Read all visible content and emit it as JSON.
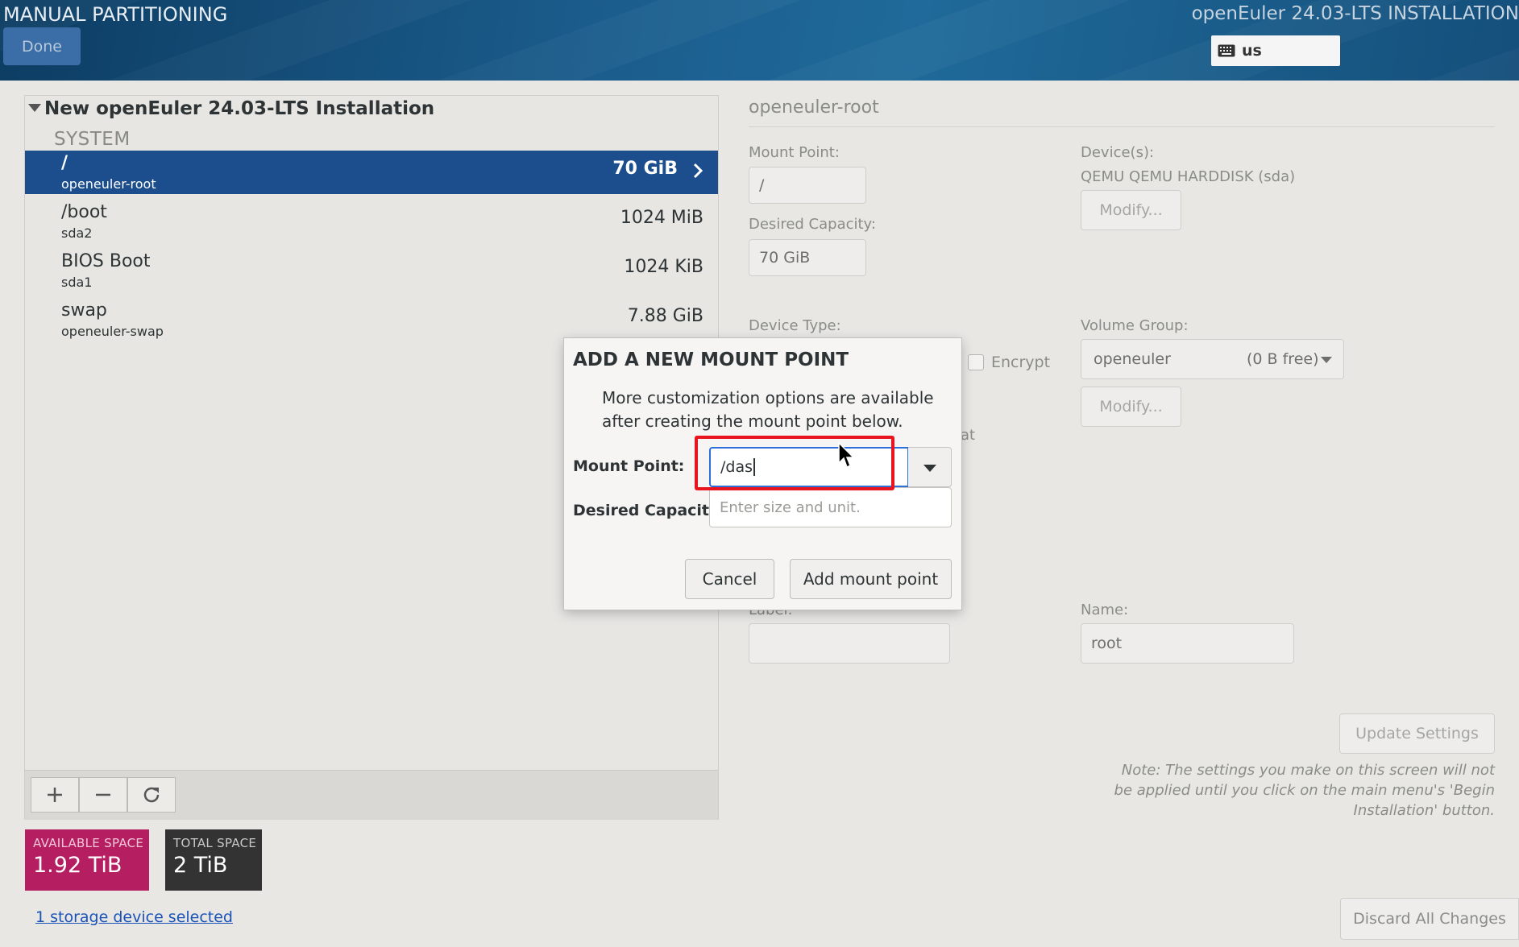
{
  "header": {
    "title": "MANUAL PARTITIONING",
    "done_label": "Done",
    "installer_title": "openEuler 24.03-LTS INSTALLATION",
    "keyboard_layout": "us"
  },
  "left_panel": {
    "group_title": "New openEuler 24.03-LTS Installation",
    "system_label": "SYSTEM",
    "partitions": [
      {
        "name": "/",
        "device": "openeuler-root",
        "size": "70 GiB",
        "selected": true
      },
      {
        "name": "/boot",
        "device": "sda2",
        "size": "1024 MiB",
        "selected": false
      },
      {
        "name": "BIOS Boot",
        "device": "sda1",
        "size": "1024 KiB",
        "selected": false
      },
      {
        "name": "swap",
        "device": "openeuler-swap",
        "size": "7.88 GiB",
        "selected": false
      }
    ],
    "toolbar": {
      "add_icon": "plus-icon",
      "remove_icon": "minus-icon",
      "refresh_icon": "refresh-icon"
    },
    "available_space": {
      "label": "AVAILABLE SPACE",
      "value": "1.92 TiB"
    },
    "total_space": {
      "label": "TOTAL SPACE",
      "value": "2 TiB"
    },
    "storage_link": "1 storage device selected"
  },
  "right_panel": {
    "title": "openeuler-root",
    "mount_point_label": "Mount Point:",
    "mount_point_value": "/",
    "desired_capacity_label": "Desired Capacity:",
    "desired_capacity_value": "70 GiB",
    "devices_label": "Device(s):",
    "devices_value": "QEMU QEMU HARDDISK (sda)",
    "modify_label": "Modify...",
    "device_type_label": "Device Type:",
    "encrypt_label": "Encrypt",
    "volume_group_label": "Volume Group:",
    "volume_group_name": "openeuler",
    "volume_group_free": "(0 B free)",
    "vg_modify_label": "Modify...",
    "partial_text": "at",
    "label_label": "Label:",
    "name_label": "Name:",
    "name_value": "root",
    "update_settings_label": "Update Settings",
    "note": "Note:  The settings you make on this screen will not be applied until you click on the main menu's 'Begin Installation' button.",
    "discard_label": "Discard All Changes"
  },
  "dialog": {
    "title": "ADD A NEW MOUNT POINT",
    "description": "More customization options are available after creating the mount point below.",
    "mount_point_label": "Mount Point:",
    "mount_point_value": "/das",
    "capacity_label": "Desired Capacity:",
    "capacity_placeholder": "Enter size and unit.",
    "cancel_label": "Cancel",
    "add_label": "Add mount point"
  },
  "colors": {
    "header_bg": "#1b5d8d",
    "selected_row": "#1c4e8d",
    "available_space": "#b51f62",
    "total_space": "#333333",
    "link": "#1a53b8",
    "highlight": "#e8141e",
    "input_focus": "#2f6fdb"
  }
}
